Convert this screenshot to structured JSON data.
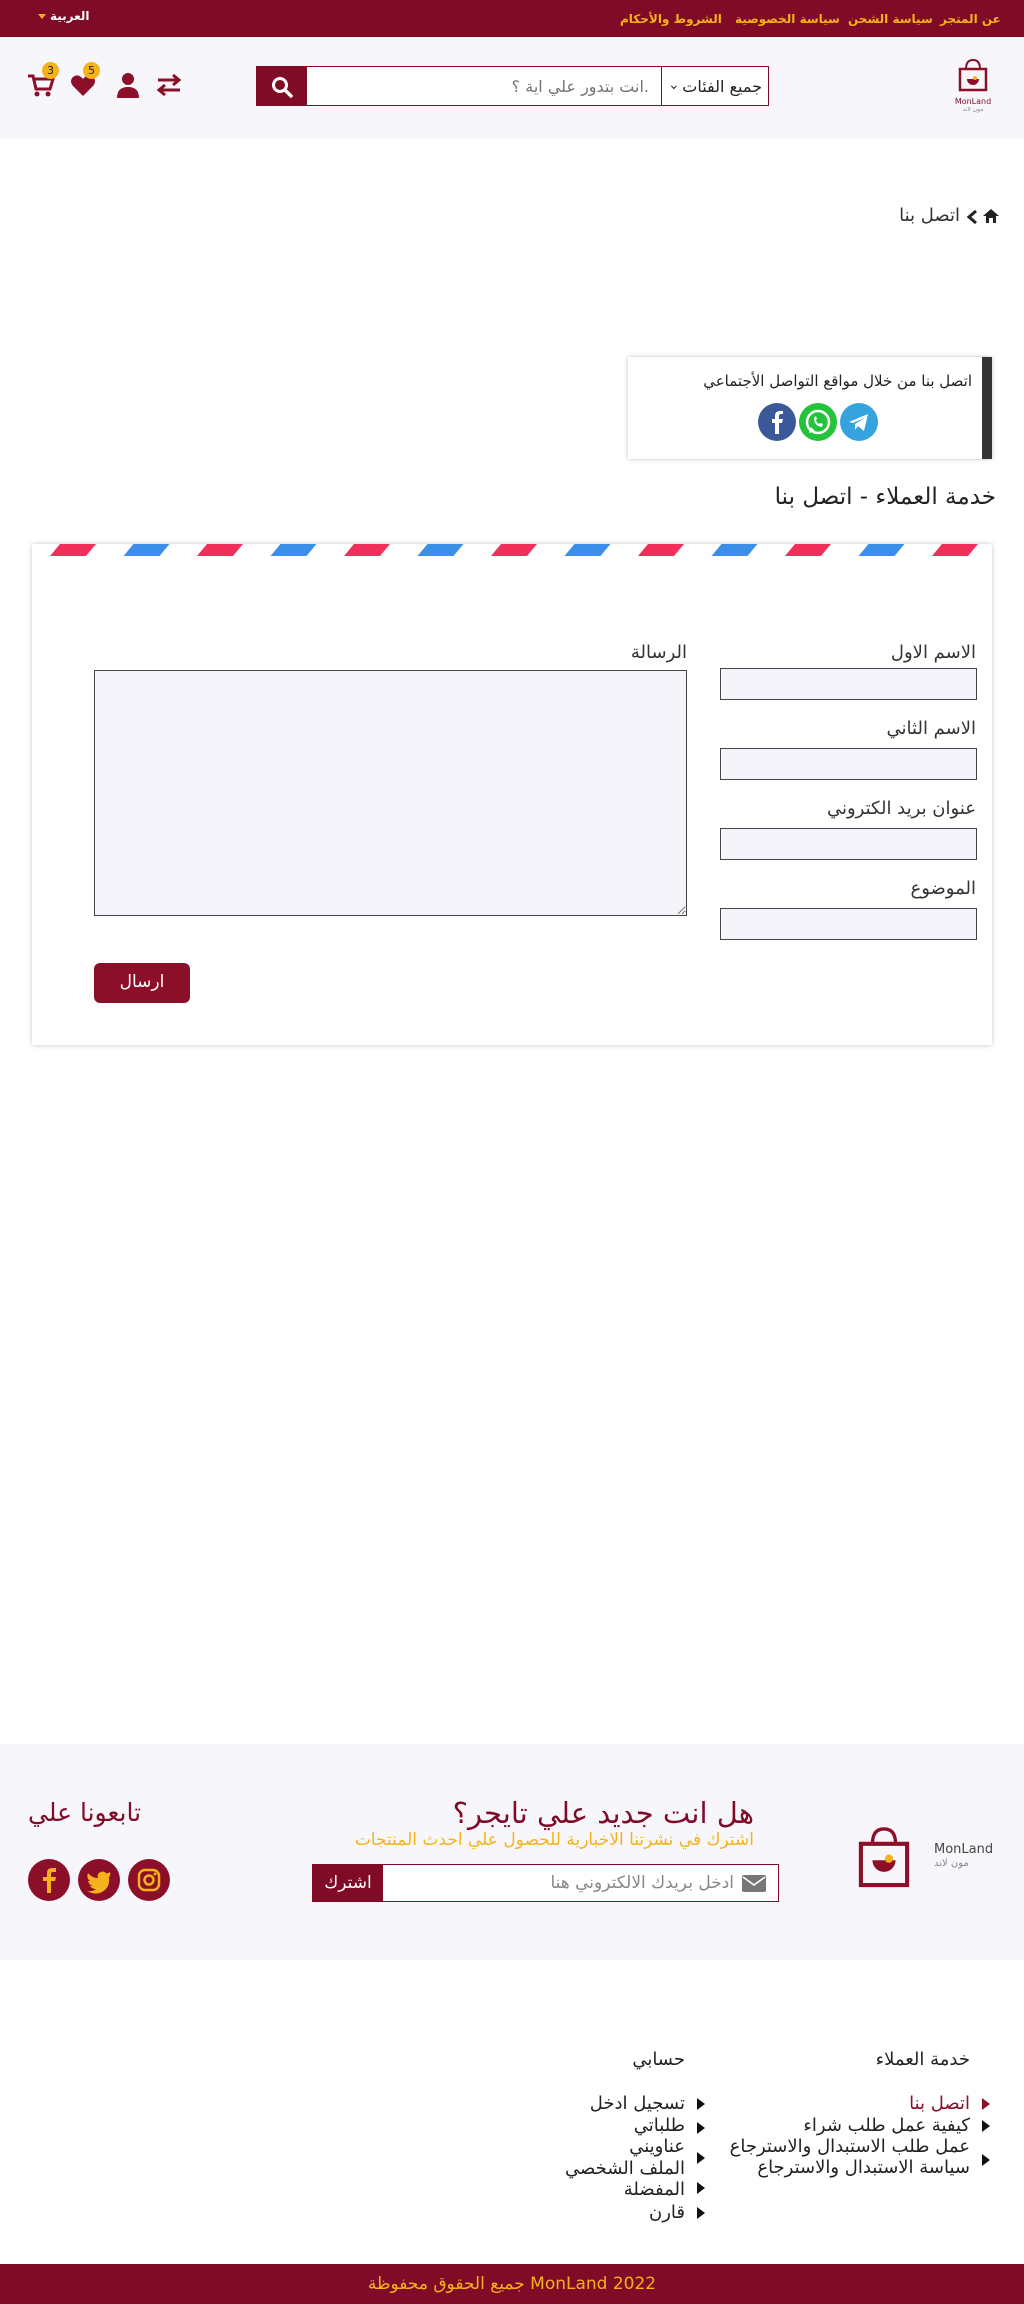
{
  "topbar": {
    "language": "العربية",
    "links": [
      "عن المتجر",
      "سياسة الشحن",
      "سياسة الخصوصية",
      "الشروط والأحكام"
    ]
  },
  "logo": {
    "name": "MonLand",
    "subtitle": "مون لاند"
  },
  "search": {
    "category": "جميع الفئات",
    "placeholder": "انت بتدور علي اية ؟."
  },
  "header_icons": {
    "cart_count": "3",
    "wishlist_count": "5"
  },
  "breadcrumb": {
    "current": "اتصل بنا"
  },
  "social_box": {
    "title": "اتصل بنا من خلال مواقع التواصل الأجتماعي"
  },
  "page_title": "خدمة العملاء - اتصل بنا",
  "form": {
    "first_name_label": "الاسم الاول",
    "last_name_label": "الاسم الثاني",
    "email_label": "عنوان بريد الكتروني",
    "subject_label": "الموضوع",
    "message_label": "الرسالة",
    "send_label": "ارسال"
  },
  "newsletter": {
    "question": "هل انت جديد علي تايجر؟",
    "subtitle": "اشترك في نشرتنا الاخبارية للحصول علي احدث المنتجات",
    "placeholder": "ادخل بريدك الالكتروني هنا",
    "subscribe": "اشترك",
    "follow": "تابعونا علي"
  },
  "footer": {
    "customer_service": {
      "title": "خدمة العملاء",
      "items": [
        "اتصل بنا",
        "كيفية عمل طلب شراء",
        "عمل طلب الاستبدال والاسترجاع",
        "سياسة الاستبدال والاسترجاع"
      ]
    },
    "account": {
      "title": "حسابي",
      "items": [
        "تسجيل  ادخل",
        "طلباتي",
        "عناويني",
        "الملف الشخصي",
        "المفضلة",
        "قارن"
      ]
    },
    "copyright": "جميع الحقوق محفوظة  MonLand 2022"
  },
  "colors": {
    "brand": "#7f0b27",
    "accent": "#f5b21b"
  }
}
